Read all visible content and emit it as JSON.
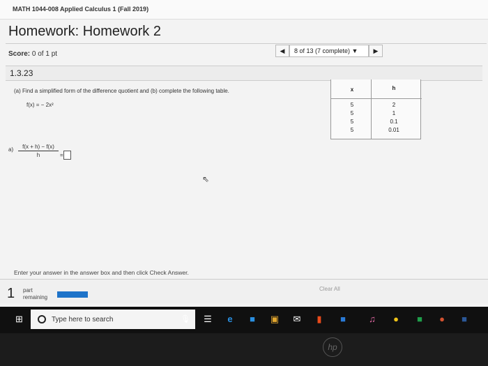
{
  "course": {
    "title": "MATH 1044-008 Applied Calculus 1 (Fall 2019)"
  },
  "homework": {
    "title": "Homework: Homework 2"
  },
  "score": {
    "label": "Score:",
    "value": "0 of 1 pt"
  },
  "question_nav": {
    "prev_icon": "◀",
    "selector": "8 of 13 (7 complete) ▼",
    "next_icon": "▶"
  },
  "question": {
    "number": "1.3.23",
    "prompt": "(a) Find a simplified form of the difference quotient and (b) complete the following table.",
    "function": "f(x) = − 2x²",
    "table": {
      "headers": [
        "x",
        "h"
      ],
      "rows": [
        [
          "5",
          "2"
        ],
        [
          "5",
          "1"
        ],
        [
          "5",
          "0.1"
        ],
        [
          "5",
          "0.01"
        ]
      ]
    },
    "part_a": {
      "label": "a)",
      "numerator": "f(x + h) − f(x)",
      "denominator": "h",
      "equals": "="
    }
  },
  "instructions": "Enter your answer in the answer box and then click Check Answer.",
  "footer": {
    "parts_count": "1",
    "parts_label_1": "part",
    "parts_label_2": "remaining",
    "progress_fraction": 0.0,
    "clear_all": "Clear All"
  },
  "taskbar": {
    "search_placeholder": "Type here to search",
    "icons": [
      "windows-start",
      "microphone",
      "task-view",
      "edge",
      "file-explorer",
      "store",
      "mail",
      "office",
      "outlook",
      "itunes",
      "chrome",
      "excel",
      "powerpoint",
      "word"
    ]
  },
  "colors": {
    "progress": "#1e73c9",
    "taskbar": "#101010",
    "page_bg": "#f3f3f3"
  }
}
